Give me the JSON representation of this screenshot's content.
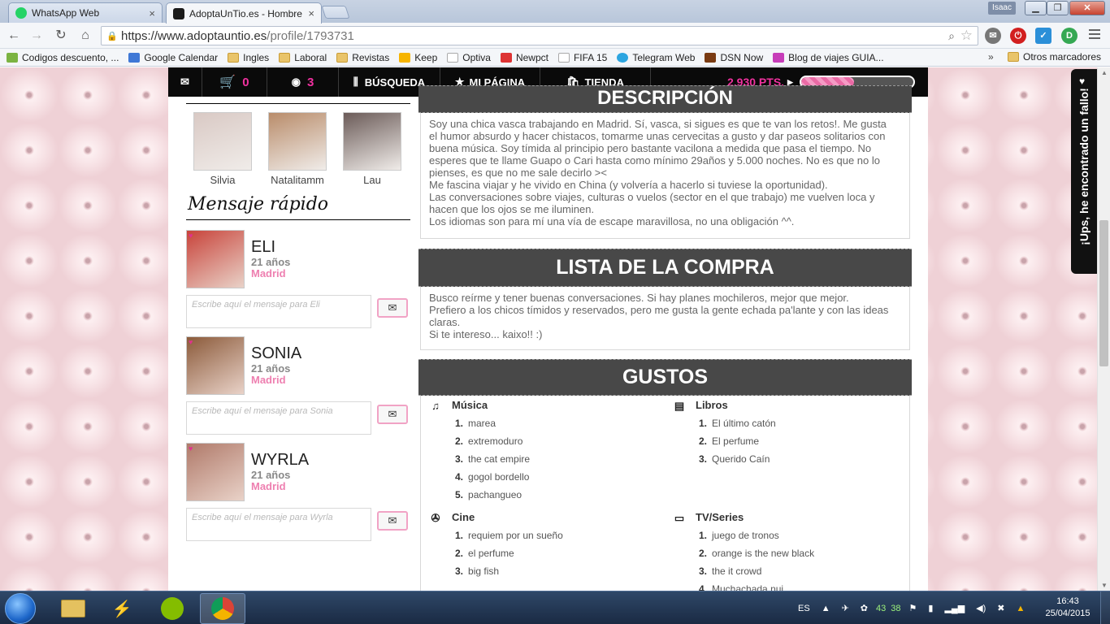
{
  "browser": {
    "tabs": [
      {
        "title": "WhatsApp Web",
        "color": "#25d366"
      },
      {
        "title": "AdoptaUnTio.es - Hombre",
        "color": "#1a1a1a"
      }
    ],
    "user_badge": "Isaac",
    "url_host": "https://www.adoptauntio.es",
    "url_path": "/profile/1793731",
    "bookmarks": [
      {
        "label": "Codigos descuento, ...",
        "icon": "#7bb342"
      },
      {
        "label": "Google Calendar",
        "icon": "#3f78d6"
      },
      {
        "label": "Ingles",
        "icon": "folder"
      },
      {
        "label": "Laboral",
        "icon": "folder"
      },
      {
        "label": "Revistas",
        "icon": "folder"
      },
      {
        "label": "Keep",
        "icon": "#f6b400"
      },
      {
        "label": "Optiva",
        "icon": "#ffffff"
      },
      {
        "label": "Newpct",
        "icon": "#d33"
      },
      {
        "label": "FIFA 15",
        "icon": "#ffffff"
      },
      {
        "label": "Telegram Web",
        "icon": "#2ca5e0"
      },
      {
        "label": "DSN Now",
        "icon": "#7a3b12"
      },
      {
        "label": "Blog de viajes GUIA...",
        "icon": "#c73db9"
      }
    ],
    "bookmarks_overflow": "»",
    "other_bookmarks": "Otros marcadores"
  },
  "site_nav": {
    "cart_count": "0",
    "coin_count": "3",
    "search": "BÚSQUEDA",
    "my_page": "MI PÁGINA",
    "shop": "TIENDA",
    "points": "2.930 PTS.",
    "points_progress": 0.47
  },
  "visitors": [
    {
      "name": "Silvia",
      "color": "#d9c9c4"
    },
    {
      "name": "Natalitamm",
      "color": "#b98c6a"
    },
    {
      "name": "Lau",
      "color": "#6b5b58"
    }
  ],
  "quick_message": {
    "title": "Mensaje rápido",
    "items": [
      {
        "name": "ELI",
        "age": "21 años",
        "city": "Madrid",
        "placeholder": "Escribe aquí el mensaje para Eli",
        "color": "#c8433a"
      },
      {
        "name": "SONIA",
        "age": "21 años",
        "city": "Madrid",
        "placeholder": "Escribe aquí el mensaje para Sonia",
        "color": "#8b5a3a"
      },
      {
        "name": "WYRLA",
        "age": "21 años",
        "city": "Madrid",
        "placeholder": "Escribe aquí el mensaje para Wyrla",
        "color": "#b07a6a"
      }
    ]
  },
  "description": {
    "title": "DESCRIPCIÓN",
    "lines": [
      "Soy una chica vasca trabajando en Madrid. Sí, vasca, si sigues es que te van los retos!. Me gusta",
      "el humor absurdo y hacer chistacos, tomarme unas cervecitas a gusto y dar paseos solitarios con",
      "buena música. Soy tímida al principio pero bastante vacilona a medida que pasa el tiempo. No",
      "esperes que te llame Guapo o Cari hasta como mínimo 29años y 5.000 noches. No es que no lo",
      "pienses, es que no me sale decirlo ><",
      "Me fascina viajar y he vivido en China (y volvería a hacerlo si tuviese la oportunidad).",
      "Las conversaciones sobre viajes, culturas o vuelos (sector en el que trabajo) me vuelven loca y",
      "hacen que los ojos se me iluminen.",
      "Los idiomas son para mí una vía de escape maravillosa, no una obligación ^^."
    ]
  },
  "shopping_list": {
    "title": "LISTA DE LA COMPRA",
    "lines": [
      "Busco reírme y tener buenas conversaciones. Si hay planes mochileros, mejor que mejor.",
      "Prefiero a los chicos tímidos y reservados, pero me gusta la gente echada pa'lante y con las ideas",
      "claras.",
      "Si te intereso... kaixo!! :)"
    ]
  },
  "tastes": {
    "title": "GUSTOS",
    "music": {
      "label": "Música",
      "items": [
        "marea",
        "extremoduro",
        "the cat empire",
        "gogol bordello",
        "pachangueo"
      ]
    },
    "books": {
      "label": "Libros",
      "items": [
        "El último catón",
        "El perfume",
        "Querido Caín"
      ]
    },
    "cinema": {
      "label": "Cine",
      "items": [
        "requiem por un sueño",
        "el perfume",
        "big fish"
      ]
    },
    "tv": {
      "label": "TV/Series",
      "items": [
        "juego de tronos",
        "orange is the new black",
        "the it crowd",
        "Muchachada nui"
      ]
    }
  },
  "bug_report": "¡Ups, he encontrado un fallo!",
  "taskbar": {
    "lang": "ES",
    "tray_nums": [
      "43",
      "38"
    ],
    "time": "16:43",
    "date": "25/04/2015"
  }
}
